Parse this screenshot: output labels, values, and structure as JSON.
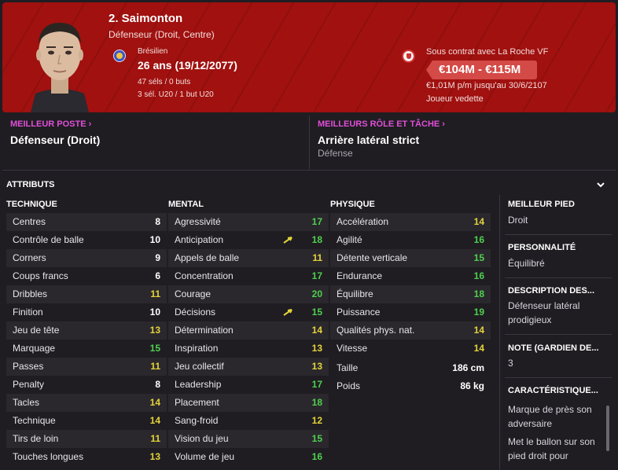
{
  "header": {
    "name": "2. Saimonton",
    "position": "Défenseur (Droit, Centre)",
    "nationality": "Brésilien",
    "age": "26 ans (19/12/2077)",
    "caps": "47 séls / 0 buts",
    "youth_caps": "3 sél. U20 / 1 but U20",
    "contract": "Sous contrat avec La Roche VF",
    "value": "€104M - €115M",
    "wage": "€1,01M p/m jusqu'au 30/6/2107",
    "status": "Joueur vedette",
    "colors": {
      "banner": "#a0110f",
      "pill": "#d44a46"
    }
  },
  "best_position": {
    "title": "MEILLEUR POSTE",
    "value": "Défenseur (Droit)"
  },
  "best_role": {
    "title": "MEILLEURS RÔLE ET TÂCHE",
    "value": "Arrière latéral strict",
    "duty": "Défense"
  },
  "attributes_title": "ATTRIBUTS",
  "colors": {
    "white": "#ffffff",
    "yellow": "#e4d33a",
    "green": "#4fd04f",
    "accent": "#e04fd8"
  },
  "technique": {
    "title": "TECHNIQUE",
    "items": [
      {
        "label": "Centres",
        "value": "8"
      },
      {
        "label": "Contrôle de balle",
        "value": "10"
      },
      {
        "label": "Corners",
        "value": "9"
      },
      {
        "label": "Coups francs",
        "value": "6"
      },
      {
        "label": "Dribbles",
        "value": "11"
      },
      {
        "label": "Finition",
        "value": "10"
      },
      {
        "label": "Jeu de tête",
        "value": "13"
      },
      {
        "label": "Marquage",
        "value": "15"
      },
      {
        "label": "Passes",
        "value": "11"
      },
      {
        "label": "Penalty",
        "value": "8"
      },
      {
        "label": "Tacles",
        "value": "14"
      },
      {
        "label": "Technique",
        "value": "14"
      },
      {
        "label": "Tirs de loin",
        "value": "11"
      },
      {
        "label": "Touches longues",
        "value": "13"
      }
    ]
  },
  "mental": {
    "title": "MENTAL",
    "items": [
      {
        "label": "Agressivité",
        "value": "17"
      },
      {
        "label": "Anticipation",
        "value": "18",
        "arrow": true
      },
      {
        "label": "Appels de balle",
        "value": "11"
      },
      {
        "label": "Concentration",
        "value": "17"
      },
      {
        "label": "Courage",
        "value": "20"
      },
      {
        "label": "Décisions",
        "value": "15",
        "arrow": true
      },
      {
        "label": "Détermination",
        "value": "14"
      },
      {
        "label": "Inspiration",
        "value": "13"
      },
      {
        "label": "Jeu collectif",
        "value": "13"
      },
      {
        "label": "Leadership",
        "value": "17"
      },
      {
        "label": "Placement",
        "value": "18"
      },
      {
        "label": "Sang-froid",
        "value": "12"
      },
      {
        "label": "Vision du jeu",
        "value": "15"
      },
      {
        "label": "Volume de jeu",
        "value": "16"
      }
    ]
  },
  "physique": {
    "title": "PHYSIQUE",
    "items": [
      {
        "label": "Accélération",
        "value": "14"
      },
      {
        "label": "Agilité",
        "value": "16"
      },
      {
        "label": "Détente verticale",
        "value": "15"
      },
      {
        "label": "Endurance",
        "value": "16"
      },
      {
        "label": "Équilibre",
        "value": "18"
      },
      {
        "label": "Puissance",
        "value": "19"
      },
      {
        "label": "Qualités phys. nat.",
        "value": "14"
      },
      {
        "label": "Vitesse",
        "value": "14"
      }
    ],
    "height_label": "Taille",
    "height": "186 cm",
    "weight_label": "Poids",
    "weight": "86 kg"
  },
  "side": {
    "foot_title": "MEILLEUR PIED",
    "foot": "Droit",
    "personality_title": "PERSONNALITÉ",
    "personality": "Équilibré",
    "description_title": "DESCRIPTION DES...",
    "description": "Défenseur latéral prodigieux",
    "gk_title": "NOTE (GARDIEN DE...",
    "gk": "3",
    "traits_title": "CARACTÉRISTIQUE...",
    "trait1": "Marque de près son adversaire",
    "trait2": "Met le ballon sur son pied droit pour"
  }
}
